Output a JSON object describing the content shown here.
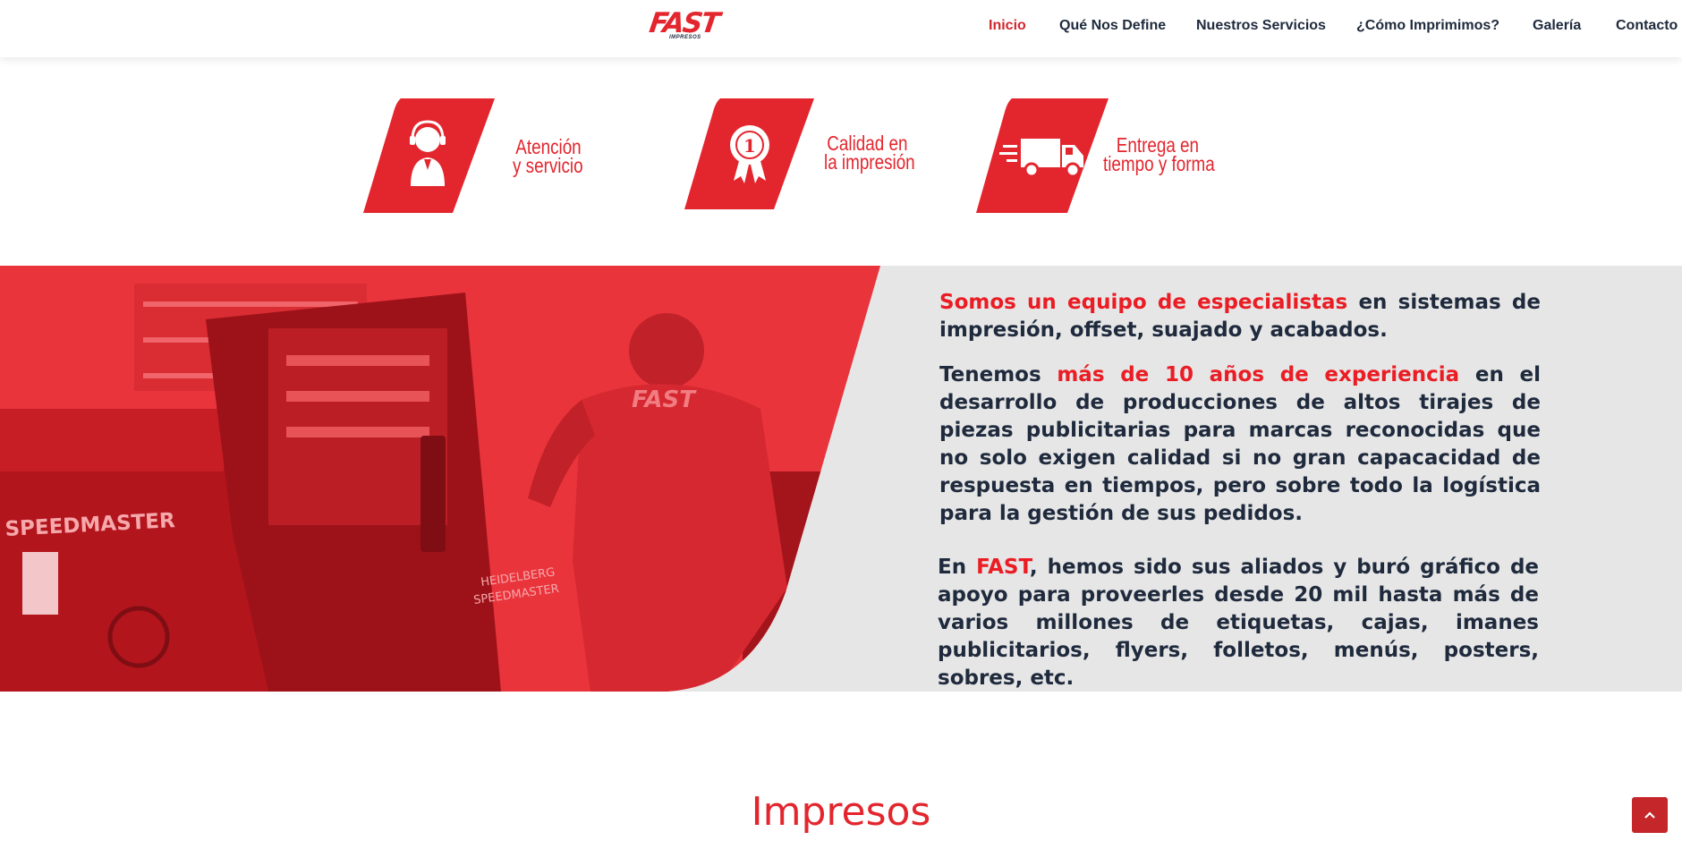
{
  "brand": {
    "logo_text": "FAST",
    "logo_sub": "IMPRESOS",
    "color": "#e3262e"
  },
  "nav": {
    "items": [
      {
        "label": "Inicio",
        "active": true
      },
      {
        "label": "Qué Nos Define"
      },
      {
        "label": "Nuestros Servicios"
      },
      {
        "label": "¿Cómo Imprimimos?"
      },
      {
        "label": "Galería"
      },
      {
        "label": "Contacto"
      }
    ]
  },
  "features": [
    {
      "icon": "headset-agent-icon",
      "line1": "Atención",
      "line2": "y servicio"
    },
    {
      "icon": "award-ribbon-icon",
      "badge": "1",
      "line1": "Calidad en",
      "line2": "la impresión"
    },
    {
      "icon": "delivery-truck-icon",
      "line1": "Entrega en",
      "line2": "tiempo y forma"
    }
  ],
  "hero": {
    "photo_labels": {
      "machine": "SPEEDMASTER",
      "machine_side_1": "HEIDELBERG",
      "machine_side_2": "SPEEDMASTER",
      "shirt": "FAST"
    },
    "p1_red": "Somos un equipo de especialistas",
    "p1_rest": " en sistemas de impresión, offset, suajado y acabados.",
    "p2_start": "Tenemos ",
    "p2_red": "más de 10 años de experiencia",
    "p2_rest": " en el desarrollo de producciones de altos tirajes de piezas publicitarias para marcas reconocidas que no solo exigen calidad si no gran capacacidad de respuesta en tiempos, pero sobre todo la logística para la gestión de sus pedidos.",
    "p3_start": "En ",
    "p3_red": "FAST",
    "p3_rest": ", hemos sido sus aliados y buró gráfico de apoyo para proveerles desde 20 mil hasta más de varios millones de etiquetas, cajas, imanes publicitarios, flyers, folletos, menús, posters, sobres, etc."
  },
  "section": {
    "title": "Impresos"
  },
  "colors": {
    "accent": "#e3262e",
    "text": "#1f2a3d",
    "band_bg": "#e6e6e6",
    "to_top": "#c4262a"
  }
}
